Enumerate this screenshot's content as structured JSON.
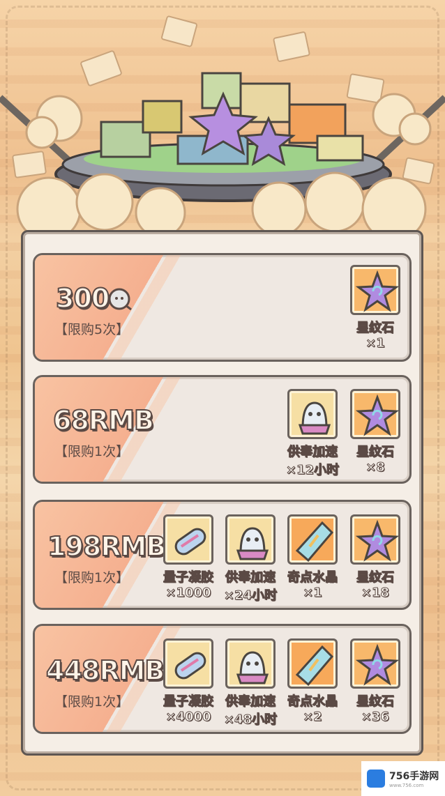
{
  "packs": [
    {
      "price": "300",
      "price_icon": "ghost-coin-icon",
      "limit": "【限购5次】",
      "items": [
        {
          "icon": "star-stone-icon",
          "name": "星纹石",
          "qty": "×1"
        }
      ]
    },
    {
      "price": "68RMB",
      "limit": "【限购1次】",
      "items": [
        {
          "icon": "offering-boost-icon",
          "name": "供奉加速",
          "qty": "×12小时"
        },
        {
          "icon": "star-stone-icon",
          "name": "星纹石",
          "qty": "×8"
        }
      ]
    },
    {
      "price": "198RMB",
      "limit": "【限购1次】",
      "items": [
        {
          "icon": "quantum-gel-icon",
          "name": "量子凝胶",
          "qty": "×1000"
        },
        {
          "icon": "offering-boost-icon",
          "name": "供奉加速",
          "qty": "×24小时"
        },
        {
          "icon": "singularity-crystal-icon",
          "name": "奇点水晶",
          "qty": "×1"
        },
        {
          "icon": "star-stone-icon",
          "name": "星纹石",
          "qty": "×18"
        }
      ]
    },
    {
      "price": "448RMB",
      "limit": "【限购1次】",
      "items": [
        {
          "icon": "quantum-gel-icon",
          "name": "量子凝胶",
          "qty": "×4000"
        },
        {
          "icon": "offering-boost-icon",
          "name": "供奉加速",
          "qty": "×48小时"
        },
        {
          "icon": "singularity-crystal-icon",
          "name": "奇点水晶",
          "qty": "×2"
        },
        {
          "icon": "star-stone-icon",
          "name": "星纹石",
          "qty": "×36"
        }
      ]
    }
  ],
  "watermark": {
    "title": "756手游网",
    "url": "www.756.com"
  },
  "colors": {
    "panel_border": "#5e5652",
    "card_bg": "#efe8e2",
    "stripe": "#f5b090",
    "star_bg": "#f8b86b"
  }
}
